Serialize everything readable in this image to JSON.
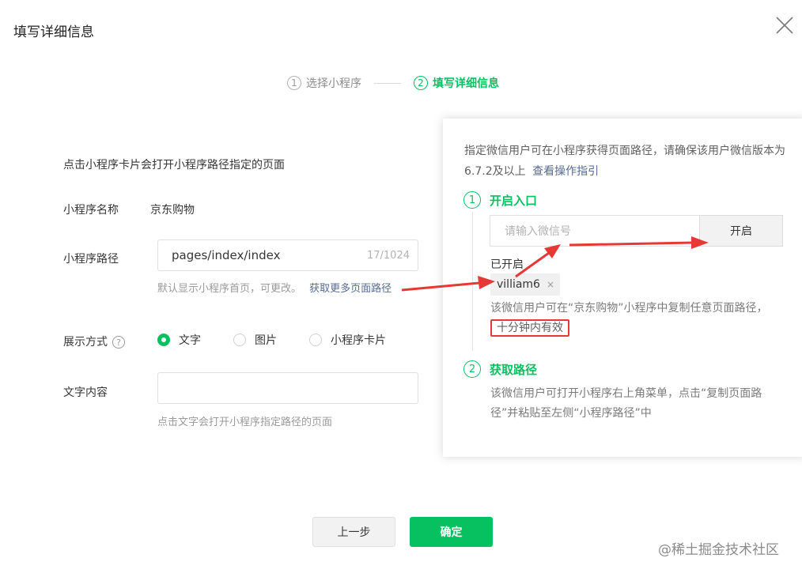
{
  "dialog": {
    "title": "填写详细信息"
  },
  "steps": [
    {
      "num": "1",
      "label": "选择小程序"
    },
    {
      "num": "2",
      "label": "填写详细信息"
    }
  ],
  "form": {
    "intro": "点击小程序卡片会打开小程序路径指定的页面",
    "name_label": "小程序名称",
    "name_value": "京东购物",
    "path_label": "小程序路径",
    "path_value": "pages/index/index",
    "path_count": "17/1024",
    "path_hint": "默认显示小程序首页，可更改。",
    "path_hint_link": "获取更多页面路径",
    "display_label": "展示方式",
    "help_glyph": "?",
    "display_options": [
      "文字",
      "图片",
      "小程序卡片"
    ],
    "display_selected": "文字",
    "text_label": "文字内容",
    "text_value": "",
    "text_hint": "点击文字会打开小程序指定路径的页面"
  },
  "buttons": {
    "prev": "上一步",
    "ok": "确定"
  },
  "panel": {
    "desc": "指定微信用户可在小程序获得页面路径，请确保该用户微信版本为6.7.2及以上",
    "desc_link": "查看操作指引",
    "step1_num": "1",
    "step1_title": "开启入口",
    "wx_placeholder": "请输入微信号",
    "open_button": "开启",
    "enabled_label": "已开启",
    "tag_value": "villiam6",
    "tag_close": "×",
    "note": "该微信用户可在“京东购物”小程序中复制任意页面路径，",
    "note_highlight": "十分钟内有效",
    "step2_num": "2",
    "step2_title": "获取路径",
    "step2_note": "该微信用户可打开小程序右上角菜单，点击“复制页面路径”并粘贴至左侧“小程序路径”中"
  },
  "watermark": "@稀土掘金技术社区",
  "colors": {
    "accent": "#07c160",
    "link": "#576b95",
    "annotation": "#e53935"
  }
}
